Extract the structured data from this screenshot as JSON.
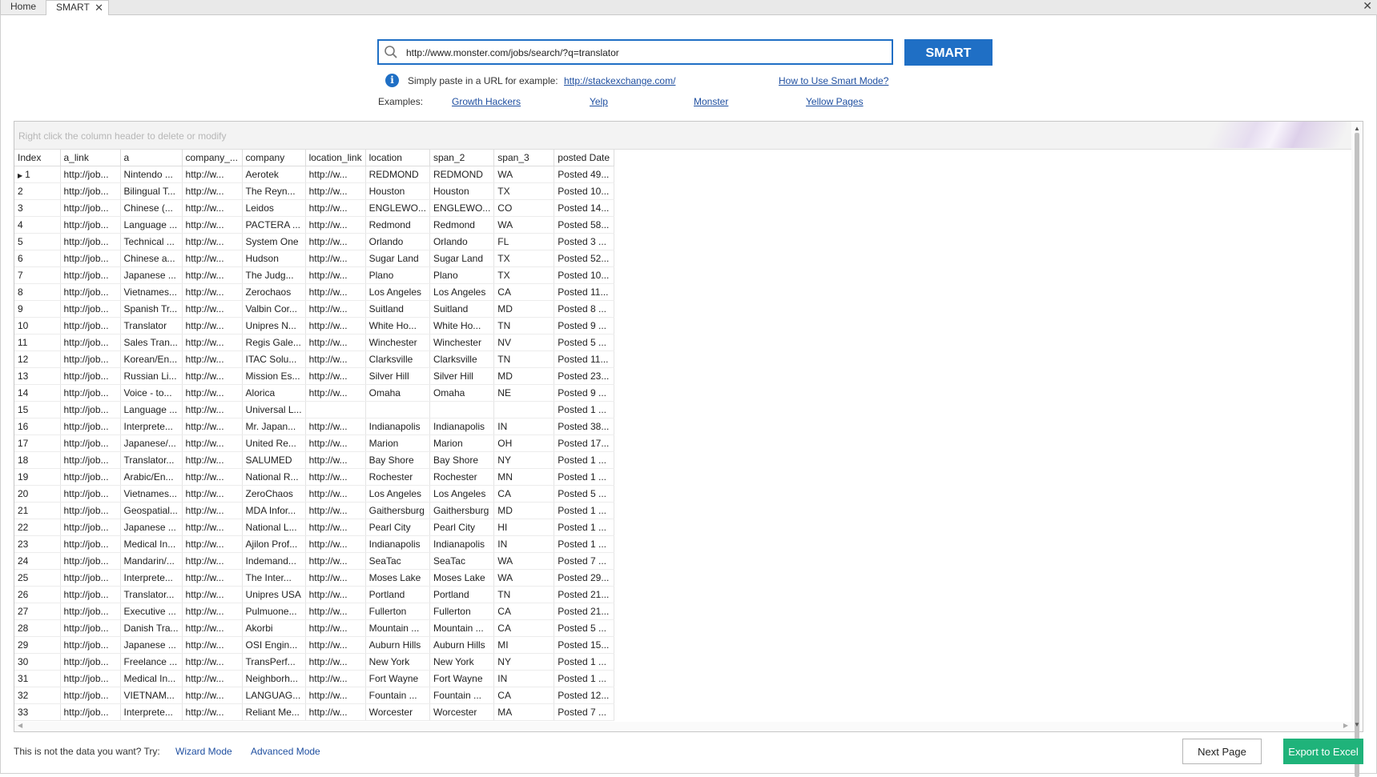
{
  "tabs": {
    "home": "Home",
    "smart": "SMART",
    "close_glyph": "✕",
    "window_close": "✕"
  },
  "search": {
    "url": "http://www.monster.com/jobs/search/?q=translator",
    "button": "SMART"
  },
  "hint": {
    "text": "Simply paste in a URL for example:",
    "example_link": "http://stackexchange.com/",
    "how_to": "How to Use Smart Mode?"
  },
  "examples": {
    "label": "Examples:",
    "items": [
      "Growth Hackers",
      "Yelp",
      "Monster",
      "Yellow Pages"
    ]
  },
  "grid": {
    "hint": "Right click the column header to delete or modify",
    "columns": [
      "Index",
      "a_link",
      "a",
      "company_...",
      "company",
      "location_link",
      "location",
      "span_2",
      "span_3",
      "posted Date"
    ],
    "rows": [
      [
        "1",
        "http://job...",
        "Nintendo ...",
        "http://w...",
        "Aerotek",
        "http://w...",
        "REDMOND",
        "REDMOND",
        "WA",
        "Posted 49..."
      ],
      [
        "2",
        "http://job...",
        "Bilingual T...",
        "http://w...",
        "The Reyn...",
        "http://w...",
        "Houston",
        "Houston",
        "TX",
        "Posted 10..."
      ],
      [
        "3",
        "http://job...",
        "Chinese (...",
        "http://w...",
        "Leidos",
        "http://w...",
        "ENGLEWO...",
        "ENGLEWO...",
        "CO",
        "Posted 14..."
      ],
      [
        "4",
        "http://job...",
        "Language ...",
        "http://w...",
        "PACTERA ...",
        "http://w...",
        "Redmond",
        "Redmond",
        "WA",
        "Posted 58..."
      ],
      [
        "5",
        "http://job...",
        "Technical ...",
        "http://w...",
        "System One",
        "http://w...",
        "Orlando",
        "Orlando",
        "FL",
        "Posted 3 ..."
      ],
      [
        "6",
        "http://job...",
        "Chinese a...",
        "http://w...",
        "Hudson",
        "http://w...",
        "Sugar Land",
        "Sugar Land",
        "TX",
        "Posted 52..."
      ],
      [
        "7",
        "http://job...",
        "Japanese ...",
        "http://w...",
        "The Judg...",
        "http://w...",
        "Plano",
        "Plano",
        "TX",
        "Posted 10..."
      ],
      [
        "8",
        "http://job...",
        "Vietnames...",
        "http://w...",
        "Zerochaos",
        "http://w...",
        "Los Angeles",
        "Los Angeles",
        "CA",
        "Posted 11..."
      ],
      [
        "9",
        "http://job...",
        "Spanish Tr...",
        "http://w...",
        "Valbin Cor...",
        "http://w...",
        "Suitland",
        "Suitland",
        "MD",
        "Posted 8 ..."
      ],
      [
        "10",
        "http://job...",
        "Translator",
        "http://w...",
        "Unipres N...",
        "http://w...",
        "White Ho...",
        "White Ho...",
        "TN",
        "Posted 9 ..."
      ],
      [
        "11",
        "http://job...",
        "Sales Tran...",
        "http://w...",
        "Regis Gale...",
        "http://w...",
        "Winchester",
        "Winchester",
        "NV",
        "Posted 5 ..."
      ],
      [
        "12",
        "http://job...",
        "Korean/En...",
        "http://w...",
        "ITAC Solu...",
        "http://w...",
        "Clarksville",
        "Clarksville",
        "TN",
        "Posted 11..."
      ],
      [
        "13",
        "http://job...",
        "Russian Li...",
        "http://w...",
        "Mission Es...",
        "http://w...",
        "Silver Hill",
        "Silver Hill",
        "MD",
        "Posted 23..."
      ],
      [
        "14",
        "http://job...",
        "Voice - to...",
        "http://w...",
        "Alorica",
        "http://w...",
        "Omaha",
        "Omaha",
        "NE",
        "Posted 9 ..."
      ],
      [
        "15",
        "http://job...",
        "Language ...",
        "http://w...",
        "Universal L...",
        "",
        "",
        "",
        "",
        "Posted 1 ..."
      ],
      [
        "16",
        "http://job...",
        "Interprete...",
        "http://w...",
        "Mr. Japan...",
        "http://w...",
        "Indianapolis",
        "Indianapolis",
        "IN",
        "Posted 38..."
      ],
      [
        "17",
        "http://job...",
        "Japanese/...",
        "http://w...",
        "United Re...",
        "http://w...",
        "Marion",
        "Marion",
        "OH",
        "Posted 17..."
      ],
      [
        "18",
        "http://job...",
        "Translator...",
        "http://w...",
        "SALUMED",
        "http://w...",
        "Bay Shore",
        "Bay Shore",
        "NY",
        "Posted 1 ..."
      ],
      [
        "19",
        "http://job...",
        "Arabic/En...",
        "http://w...",
        "National R...",
        "http://w...",
        "Rochester",
        "Rochester",
        "MN",
        "Posted 1 ..."
      ],
      [
        "20",
        "http://job...",
        "Vietnames...",
        "http://w...",
        "ZeroChaos",
        "http://w...",
        "Los Angeles",
        "Los Angeles",
        "CA",
        "Posted 5 ..."
      ],
      [
        "21",
        "http://job...",
        "Geospatial...",
        "http://w...",
        "MDA Infor...",
        "http://w...",
        "Gaithersburg",
        "Gaithersburg",
        "MD",
        "Posted 1 ..."
      ],
      [
        "22",
        "http://job...",
        "Japanese ...",
        "http://w...",
        "National L...",
        "http://w...",
        "Pearl City",
        "Pearl City",
        "HI",
        "Posted 1 ..."
      ],
      [
        "23",
        "http://job...",
        "Medical In...",
        "http://w...",
        "Ajilon Prof...",
        "http://w...",
        "Indianapolis",
        "Indianapolis",
        "IN",
        "Posted 1 ..."
      ],
      [
        "24",
        "http://job...",
        "Mandarin/...",
        "http://w...",
        "Indemand...",
        "http://w...",
        "SeaTac",
        "SeaTac",
        "WA",
        "Posted 7 ..."
      ],
      [
        "25",
        "http://job...",
        "Interprete...",
        "http://w...",
        "The Inter...",
        "http://w...",
        "Moses Lake",
        "Moses Lake",
        "WA",
        "Posted 29..."
      ],
      [
        "26",
        "http://job...",
        "Translator...",
        "http://w...",
        "Unipres USA",
        "http://w...",
        "Portland",
        "Portland",
        "TN",
        "Posted 21..."
      ],
      [
        "27",
        "http://job...",
        "Executive ...",
        "http://w...",
        "Pulmuone...",
        "http://w...",
        "Fullerton",
        "Fullerton",
        "CA",
        "Posted 21..."
      ],
      [
        "28",
        "http://job...",
        "Danish Tra...",
        "http://w...",
        "Akorbi",
        "http://w...",
        "Mountain ...",
        "Mountain ...",
        "CA",
        "Posted 5 ..."
      ],
      [
        "29",
        "http://job...",
        "Japanese ...",
        "http://w...",
        "OSI Engin...",
        "http://w...",
        "Auburn Hills",
        "Auburn Hills",
        "MI",
        "Posted 15..."
      ],
      [
        "30",
        "http://job...",
        "Freelance ...",
        "http://w...",
        "TransPerf...",
        "http://w...",
        "New York",
        "New York",
        "NY",
        "Posted 1 ..."
      ],
      [
        "31",
        "http://job...",
        "Medical In...",
        "http://w...",
        "Neighborh...",
        "http://w...",
        "Fort Wayne",
        "Fort Wayne",
        "IN",
        "Posted 1 ..."
      ],
      [
        "32",
        "http://job...",
        "VIETNAM...",
        "http://w...",
        "LANGUAG...",
        "http://w...",
        "Fountain ...",
        "Fountain ...",
        "CA",
        "Posted 12..."
      ],
      [
        "33",
        "http://job...",
        "Interprete...",
        "http://w...",
        "Reliant Me...",
        "http://w...",
        "Worcester",
        "Worcester",
        "MA",
        "Posted 7 ..."
      ]
    ]
  },
  "footer": {
    "prompt": "This is not the data you want? Try:",
    "wizard": "Wizard Mode",
    "advanced": "Advanced Mode",
    "next_page": "Next Page",
    "export": "Export to Excel"
  },
  "colors": {
    "accent": "#1f6fc5",
    "export_green": "#1fb37a",
    "link": "#1f4fa0"
  }
}
